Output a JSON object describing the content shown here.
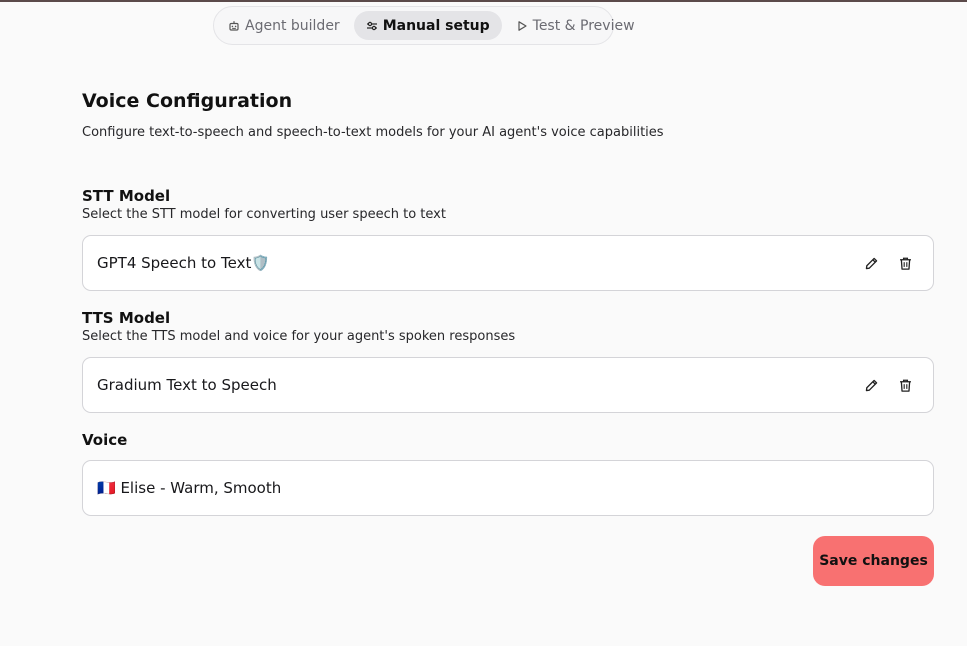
{
  "tabs": [
    {
      "label": "Agent builder",
      "icon": "robot-icon",
      "active": false
    },
    {
      "label": "Manual setup",
      "icon": "sliders-icon",
      "active": true
    },
    {
      "label": "Test & Preview",
      "icon": "play-icon",
      "active": false
    }
  ],
  "section": {
    "title": "Voice Configuration",
    "description": "Configure text-to-speech and speech-to-text models for your AI agent's voice capabilities"
  },
  "stt": {
    "label": "STT Model",
    "description": "Select the STT model for converting user speech to text",
    "value": "GPT4 Speech to Text🛡️"
  },
  "tts": {
    "label": "TTS Model",
    "description": "Select the TTS model and voice for your agent's spoken responses",
    "value": "Gradium Text to Speech"
  },
  "voice": {
    "label": "Voice",
    "value": "🇫🇷 Elise - Warm, Smooth"
  },
  "actions": {
    "save_label": "Save changes"
  },
  "colors": {
    "accent": "#f87171",
    "border": "#d4d4d8",
    "background": "#fafafa"
  }
}
